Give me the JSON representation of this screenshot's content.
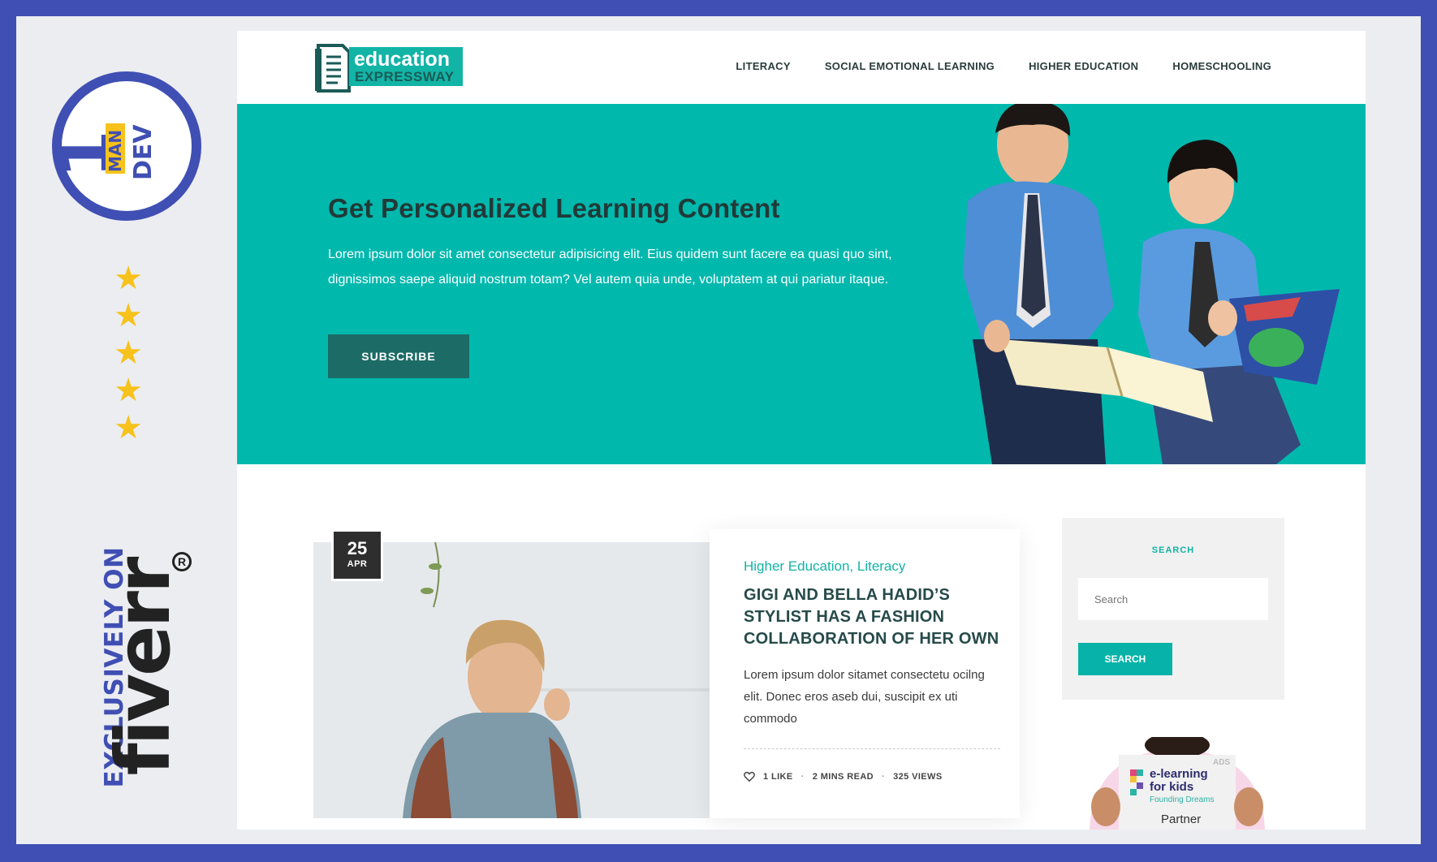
{
  "promo": {
    "badge_top": "MAN",
    "badge_one": "1",
    "badge_dev": "DEV",
    "stars": [
      "★",
      "★",
      "★",
      "★",
      "★"
    ],
    "exclusively": "EXCLUSIVELY ON",
    "fiverr": "fiverr",
    "registered": "R"
  },
  "site": {
    "logo": {
      "line1": "education",
      "line2": "EXPRESSWAY"
    },
    "nav": [
      "LITERACY",
      "SOCIAL EMOTIONAL LEARNING",
      "HIGHER EDUCATION",
      "HOMESCHOOLING"
    ],
    "hero": {
      "title": "Get Personalized Learning Content",
      "text": "Lorem ipsum dolor sit amet consectetur adipisicing elit. Eius quidem sunt facere ea quasi quo sint, dignissimos saepe aliquid nostrum totam? Vel autem quia unde, voluptatem at qui pariatur itaque.",
      "button": "SUBSCRIBE"
    },
    "post": {
      "day": "25",
      "month": "APR",
      "categories": "Higher Education, Literacy",
      "title": "GIGI AND BELLA HADID’S STYLIST HAS A FASHION COLLABORATION OF HER OWN",
      "excerpt": "Lorem ipsum dolor sitamet consectetu ocilng elit. Donec eros aseb dui, suscipit ex uti commodo",
      "likes": "1 LIKE",
      "read": "2 MINS READ",
      "views": "325 VIEWS"
    },
    "sidebar": {
      "title": "SEARCH",
      "placeholder": "Search",
      "button": "SEARCH"
    },
    "ad": {
      "tag": "ADS",
      "line1": "e-learning",
      "line2": "for kids",
      "line3": "Founding Dreams",
      "line4": "Partner"
    }
  },
  "colors": {
    "frame": "#3f4fb3",
    "teal": "#01b8ad",
    "accent": "#13b3a5",
    "dark_teal": "#1d6b66",
    "star": "#f6c21b"
  }
}
